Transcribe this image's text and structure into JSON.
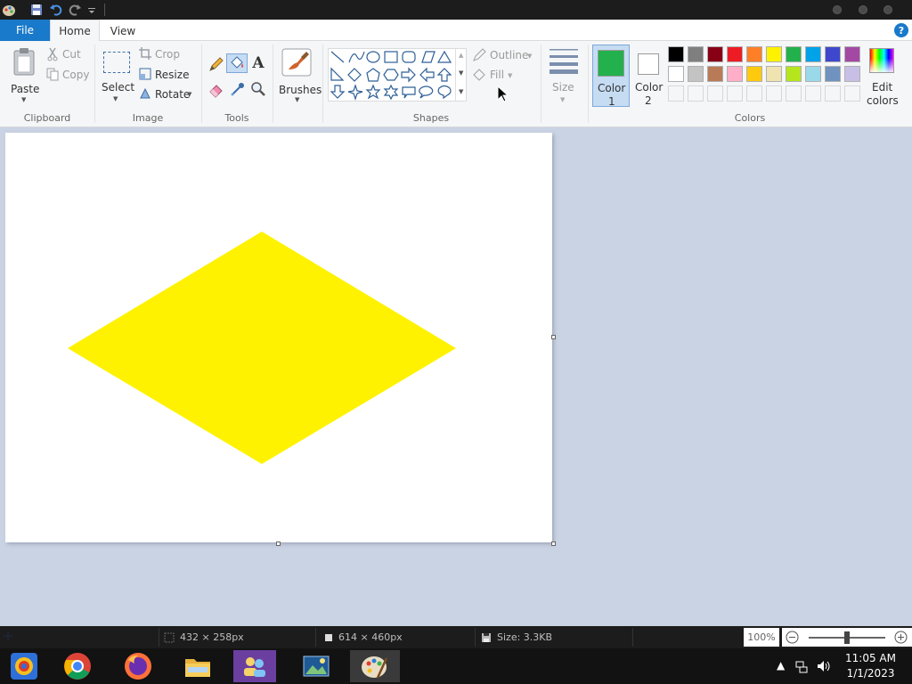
{
  "tabs": {
    "file": "File",
    "home": "Home",
    "view": "View"
  },
  "clipboard": {
    "paste": "Paste",
    "cut": "Cut",
    "copy": "Copy",
    "group": "Clipboard"
  },
  "image": {
    "select": "Select",
    "crop": "Crop",
    "resize": "Resize",
    "rotate": "Rotate",
    "group": "Image"
  },
  "tools": {
    "group": "Tools"
  },
  "brushes": {
    "label": "Brushes"
  },
  "shapes": {
    "outline": "Outline",
    "fill": "Fill",
    "group": "Shapes"
  },
  "size": {
    "label": "Size"
  },
  "colors": {
    "color1_line1": "Color",
    "color1_line2": "1",
    "color2_line1": "Color",
    "color2_line2": "2",
    "edit_line1": "Edit",
    "edit_line2": "colors",
    "group": "Colors",
    "color1_value": "#22b14c",
    "color2_value": "#ffffff",
    "palette_row1": [
      "#000000",
      "#7f7f7f",
      "#880015",
      "#ed1c24",
      "#ff7f27",
      "#fff200",
      "#22b14c",
      "#00a2e8",
      "#3f48cc",
      "#a349a4"
    ],
    "palette_row2": [
      "#ffffff",
      "#c3c3c3",
      "#b97a57",
      "#ffaec9",
      "#ffc90e",
      "#efe4b0",
      "#b5e61d",
      "#99d9ea",
      "#7092be",
      "#c8bfe7"
    ]
  },
  "canvas": {
    "shape_color": "#fff200"
  },
  "status": {
    "selection_size": "432 × 258px",
    "image_size": "614 × 460px",
    "file_size": "Size: 3.3KB",
    "zoom": "100%"
  },
  "taskbar": {
    "time": "11:05 AM",
    "date": "1/1/2023"
  }
}
